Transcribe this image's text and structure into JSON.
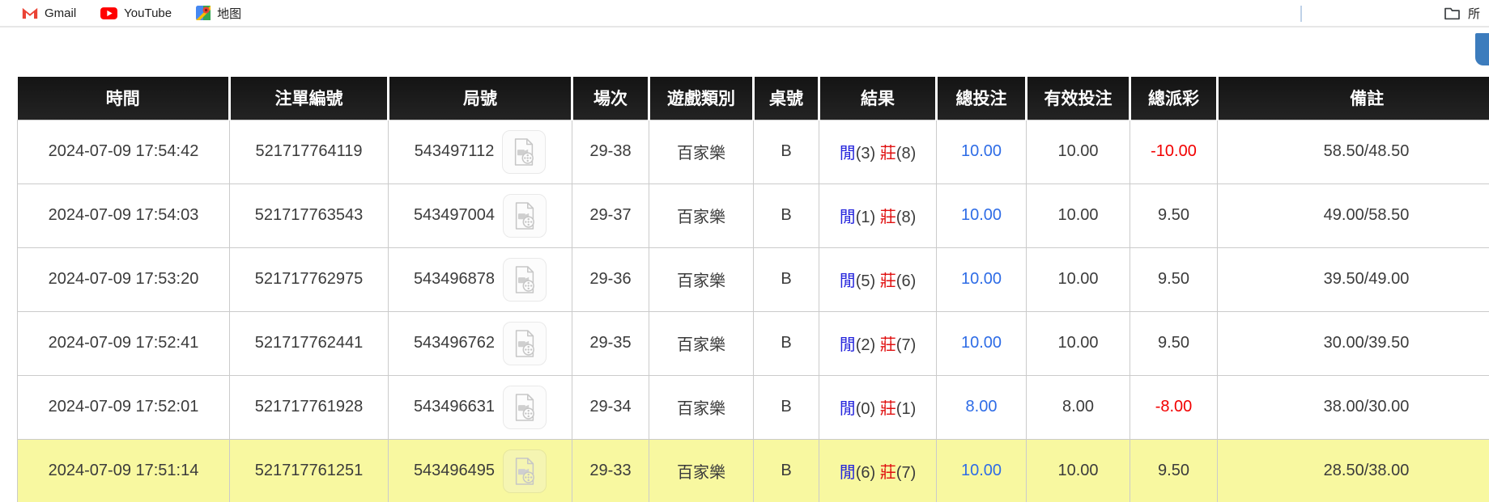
{
  "bookmarks_bar": {
    "gmail_label": "Gmail",
    "youtube_label": "YouTube",
    "maps_label": "地图",
    "all_bookmarks_label": "所"
  },
  "table": {
    "headers": [
      "時間",
      "注單編號",
      "局號",
      "場次",
      "遊戲類別",
      "桌號",
      "結果",
      "總投注",
      "有效投注",
      "總派彩",
      "備註"
    ],
    "rows": [
      {
        "time": "2024-07-09 17:54:42",
        "bet_id": "521717764119",
        "round_id": "543497112",
        "session": "29-38",
        "game_type": "百家樂",
        "table_no": "B",
        "result": {
          "player_label": "閒",
          "player_score": "(3)",
          "banker_label": "莊",
          "banker_score": "(8)"
        },
        "total_bet": "10.00",
        "valid_bet": "10.00",
        "payout": "-10.00",
        "remark": "58.50/48.50",
        "highlighted": false
      },
      {
        "time": "2024-07-09 17:54:03",
        "bet_id": "521717763543",
        "round_id": "543497004",
        "session": "29-37",
        "game_type": "百家樂",
        "table_no": "B",
        "result": {
          "player_label": "閒",
          "player_score": "(1)",
          "banker_label": "莊",
          "banker_score": "(8)"
        },
        "total_bet": "10.00",
        "valid_bet": "10.00",
        "payout": "9.50",
        "remark": "49.00/58.50",
        "highlighted": false
      },
      {
        "time": "2024-07-09 17:53:20",
        "bet_id": "521717762975",
        "round_id": "543496878",
        "session": "29-36",
        "game_type": "百家樂",
        "table_no": "B",
        "result": {
          "player_label": "閒",
          "player_score": "(5)",
          "banker_label": "莊",
          "banker_score": "(6)"
        },
        "total_bet": "10.00",
        "valid_bet": "10.00",
        "payout": "9.50",
        "remark": "39.50/49.00",
        "highlighted": false
      },
      {
        "time": "2024-07-09 17:52:41",
        "bet_id": "521717762441",
        "round_id": "543496762",
        "session": "29-35",
        "game_type": "百家樂",
        "table_no": "B",
        "result": {
          "player_label": "閒",
          "player_score": "(2)",
          "banker_label": "莊",
          "banker_score": "(7)"
        },
        "total_bet": "10.00",
        "valid_bet": "10.00",
        "payout": "9.50",
        "remark": "30.00/39.50",
        "highlighted": false
      },
      {
        "time": "2024-07-09 17:52:01",
        "bet_id": "521717761928",
        "round_id": "543496631",
        "session": "29-34",
        "game_type": "百家樂",
        "table_no": "B",
        "result": {
          "player_label": "閒",
          "player_score": "(0)",
          "banker_label": "莊",
          "banker_score": "(1)"
        },
        "total_bet": "8.00",
        "valid_bet": "8.00",
        "payout": "-8.00",
        "remark": "38.00/30.00",
        "highlighted": false
      },
      {
        "time": "2024-07-09 17:51:14",
        "bet_id": "521717761251",
        "round_id": "543496495",
        "session": "29-33",
        "game_type": "百家樂",
        "table_no": "B",
        "result": {
          "player_label": "閒",
          "player_score": "(6)",
          "banker_label": "莊",
          "banker_score": "(7)"
        },
        "total_bet": "10.00",
        "valid_bet": "10.00",
        "payout": "9.50",
        "remark": "28.50/38.00",
        "highlighted": true
      }
    ]
  },
  "colors": {
    "header_bg": "#1b1b1b",
    "highlight_row": "#f8f8a0",
    "player_blue": "#2323dc",
    "banker_red": "#e01010",
    "amount_blue": "#2e6ce6",
    "negative_red": "#f20000",
    "scrollbar_blue": "#3c7cbd"
  }
}
